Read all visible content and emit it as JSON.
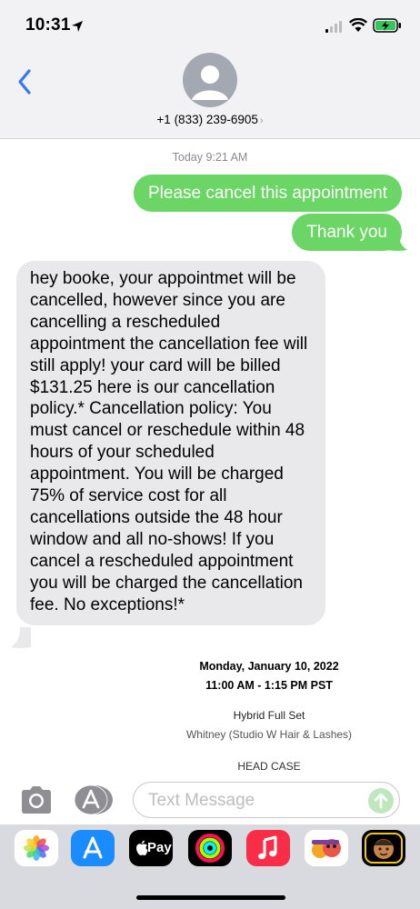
{
  "status": {
    "time": "10:31"
  },
  "header": {
    "contact": "+1 (833) 239-6905",
    "contact_chevron": "›"
  },
  "conversation": {
    "timestamp": "Today 9:21 AM",
    "outgoing": [
      "Please cancel this appointment",
      "Thank you"
    ],
    "incoming": "hey booke, your appointmet will be cancelled, however since you are cancelling a rescheduled appointment the cancellation fee will still apply! your card will be billed $131.25 here is our cancellation policy.* Cancellation policy: You must cancel or reschedule within 48 hours of your scheduled appointment. You will be charged 75% of service cost for all cancellations outside the 48 hour window and all no-shows! If you cancel a rescheduled appointment you will be charged the cancellation fee. No exceptions!*"
  },
  "preview_card": {
    "date": "Monday, January 10, 2022",
    "time": "11:00 AM - 1:15 PM PST",
    "service": "Hybrid Full Set",
    "staff": "Whitney (Studio W Hair & Lashes)",
    "location": "HEAD CASE"
  },
  "input_bar": {
    "placeholder": "Text Message"
  },
  "app_drawer": {
    "apple_pay_label": "Pay",
    "apps": [
      "photos-icon",
      "app-store-icon",
      "apple-pay-icon",
      "activity-icon",
      "music-icon",
      "memoji-icon",
      "animoji-icon"
    ]
  },
  "colors": {
    "outgoing_bubble": "#6bd666",
    "incoming_bubble": "#e9e9eb",
    "accent": "#3478f6"
  }
}
